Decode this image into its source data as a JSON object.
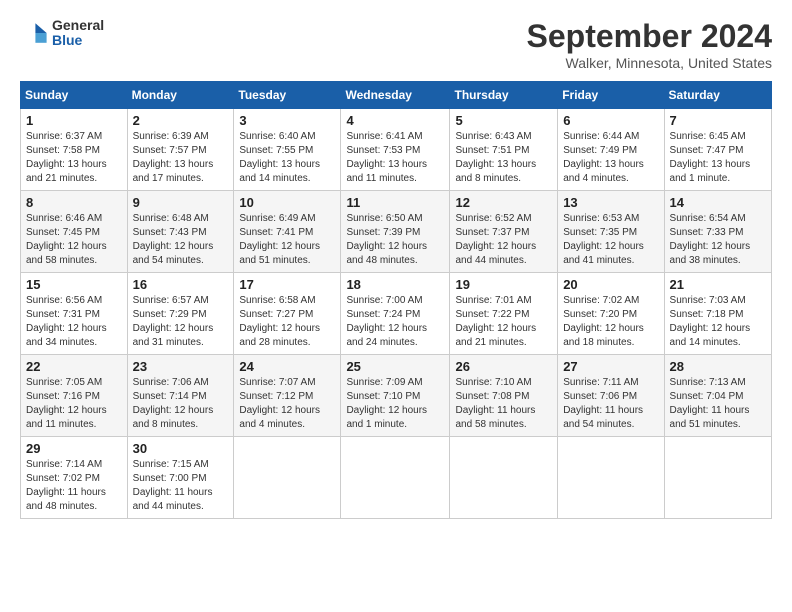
{
  "logo": {
    "general": "General",
    "blue": "Blue"
  },
  "title": "September 2024",
  "location": "Walker, Minnesota, United States",
  "weekdays": [
    "Sunday",
    "Monday",
    "Tuesday",
    "Wednesday",
    "Thursday",
    "Friday",
    "Saturday"
  ],
  "weeks": [
    [
      {
        "day": "1",
        "sunrise": "6:37 AM",
        "sunset": "7:58 PM",
        "daylight": "13 hours and 21 minutes."
      },
      {
        "day": "2",
        "sunrise": "6:39 AM",
        "sunset": "7:57 PM",
        "daylight": "13 hours and 17 minutes."
      },
      {
        "day": "3",
        "sunrise": "6:40 AM",
        "sunset": "7:55 PM",
        "daylight": "13 hours and 14 minutes."
      },
      {
        "day": "4",
        "sunrise": "6:41 AM",
        "sunset": "7:53 PM",
        "daylight": "13 hours and 11 minutes."
      },
      {
        "day": "5",
        "sunrise": "6:43 AM",
        "sunset": "7:51 PM",
        "daylight": "13 hours and 8 minutes."
      },
      {
        "day": "6",
        "sunrise": "6:44 AM",
        "sunset": "7:49 PM",
        "daylight": "13 hours and 4 minutes."
      },
      {
        "day": "7",
        "sunrise": "6:45 AM",
        "sunset": "7:47 PM",
        "daylight": "13 hours and 1 minute."
      }
    ],
    [
      {
        "day": "8",
        "sunrise": "6:46 AM",
        "sunset": "7:45 PM",
        "daylight": "12 hours and 58 minutes."
      },
      {
        "day": "9",
        "sunrise": "6:48 AM",
        "sunset": "7:43 PM",
        "daylight": "12 hours and 54 minutes."
      },
      {
        "day": "10",
        "sunrise": "6:49 AM",
        "sunset": "7:41 PM",
        "daylight": "12 hours and 51 minutes."
      },
      {
        "day": "11",
        "sunrise": "6:50 AM",
        "sunset": "7:39 PM",
        "daylight": "12 hours and 48 minutes."
      },
      {
        "day": "12",
        "sunrise": "6:52 AM",
        "sunset": "7:37 PM",
        "daylight": "12 hours and 44 minutes."
      },
      {
        "day": "13",
        "sunrise": "6:53 AM",
        "sunset": "7:35 PM",
        "daylight": "12 hours and 41 minutes."
      },
      {
        "day": "14",
        "sunrise": "6:54 AM",
        "sunset": "7:33 PM",
        "daylight": "12 hours and 38 minutes."
      }
    ],
    [
      {
        "day": "15",
        "sunrise": "6:56 AM",
        "sunset": "7:31 PM",
        "daylight": "12 hours and 34 minutes."
      },
      {
        "day": "16",
        "sunrise": "6:57 AM",
        "sunset": "7:29 PM",
        "daylight": "12 hours and 31 minutes."
      },
      {
        "day": "17",
        "sunrise": "6:58 AM",
        "sunset": "7:27 PM",
        "daylight": "12 hours and 28 minutes."
      },
      {
        "day": "18",
        "sunrise": "7:00 AM",
        "sunset": "7:24 PM",
        "daylight": "12 hours and 24 minutes."
      },
      {
        "day": "19",
        "sunrise": "7:01 AM",
        "sunset": "7:22 PM",
        "daylight": "12 hours and 21 minutes."
      },
      {
        "day": "20",
        "sunrise": "7:02 AM",
        "sunset": "7:20 PM",
        "daylight": "12 hours and 18 minutes."
      },
      {
        "day": "21",
        "sunrise": "7:03 AM",
        "sunset": "7:18 PM",
        "daylight": "12 hours and 14 minutes."
      }
    ],
    [
      {
        "day": "22",
        "sunrise": "7:05 AM",
        "sunset": "7:16 PM",
        "daylight": "12 hours and 11 minutes."
      },
      {
        "day": "23",
        "sunrise": "7:06 AM",
        "sunset": "7:14 PM",
        "daylight": "12 hours and 8 minutes."
      },
      {
        "day": "24",
        "sunrise": "7:07 AM",
        "sunset": "7:12 PM",
        "daylight": "12 hours and 4 minutes."
      },
      {
        "day": "25",
        "sunrise": "7:09 AM",
        "sunset": "7:10 PM",
        "daylight": "12 hours and 1 minute."
      },
      {
        "day": "26",
        "sunrise": "7:10 AM",
        "sunset": "7:08 PM",
        "daylight": "11 hours and 58 minutes."
      },
      {
        "day": "27",
        "sunrise": "7:11 AM",
        "sunset": "7:06 PM",
        "daylight": "11 hours and 54 minutes."
      },
      {
        "day": "28",
        "sunrise": "7:13 AM",
        "sunset": "7:04 PM",
        "daylight": "11 hours and 51 minutes."
      }
    ],
    [
      {
        "day": "29",
        "sunrise": "7:14 AM",
        "sunset": "7:02 PM",
        "daylight": "11 hours and 48 minutes."
      },
      {
        "day": "30",
        "sunrise": "7:15 AM",
        "sunset": "7:00 PM",
        "daylight": "11 hours and 44 minutes."
      },
      null,
      null,
      null,
      null,
      null
    ]
  ],
  "labels": {
    "sunrise": "Sunrise:",
    "sunset": "Sunset:",
    "daylight": "Daylight:"
  }
}
